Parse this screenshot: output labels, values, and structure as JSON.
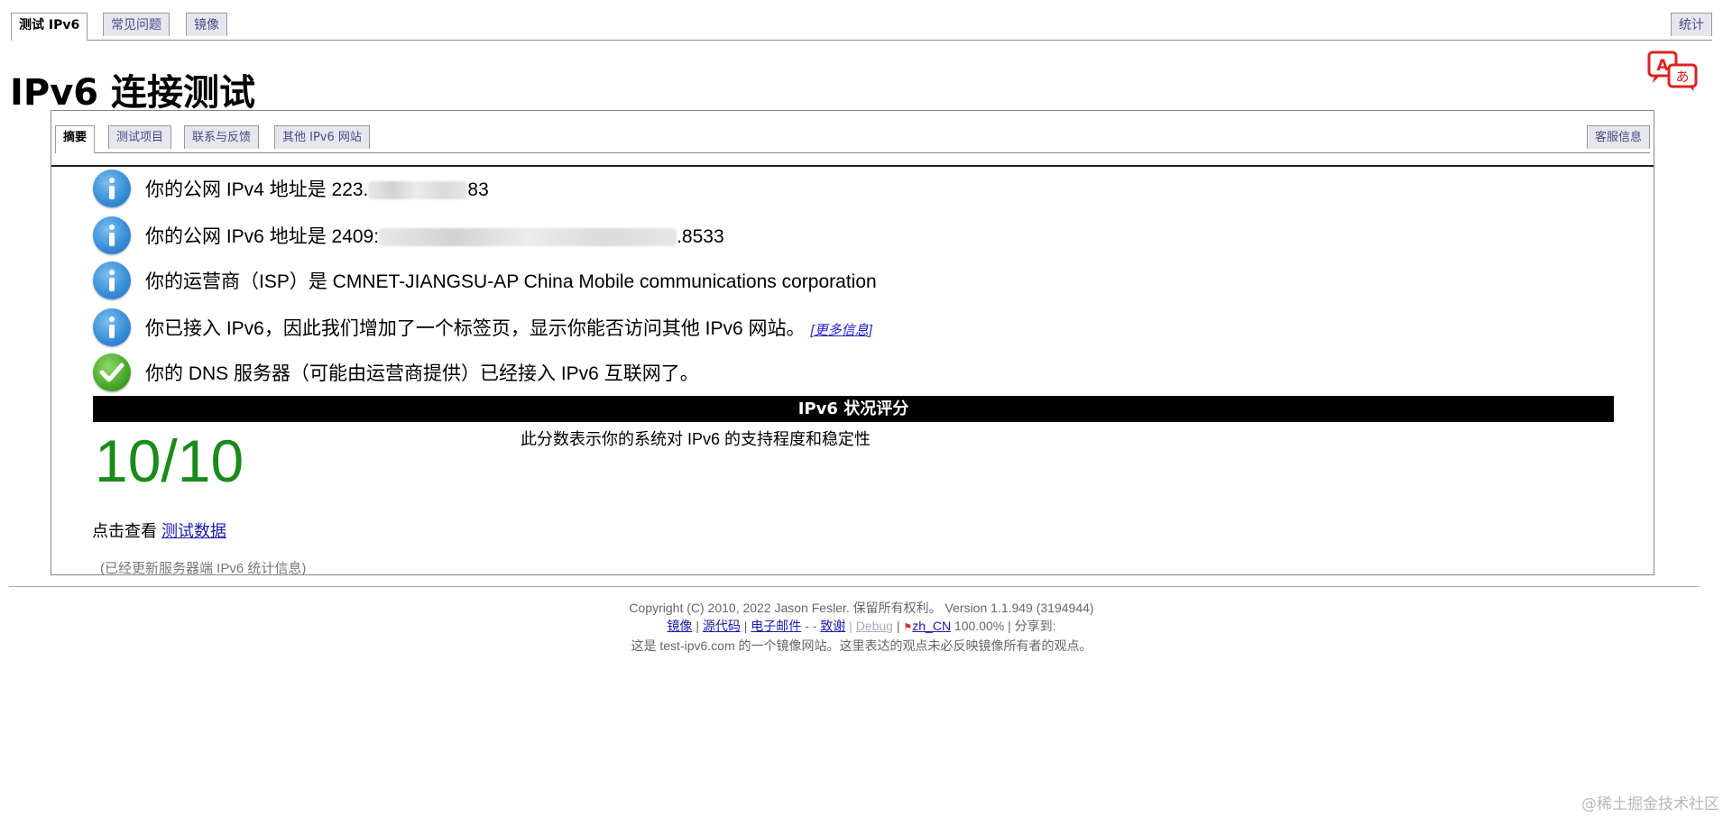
{
  "top_tabs": {
    "test": "测试 IPv6",
    "faq": "常见问题",
    "mirrors": "镜像",
    "stats": "统计"
  },
  "title": "IPv6 连接测试",
  "inner_tabs": {
    "summary": "摘要",
    "tests": "测试项目",
    "contact": "联系与反馈",
    "other_sites": "其他 IPv6 网站",
    "support": "客服信息"
  },
  "info": {
    "ipv4_prefix": "你的公网 IPv4 地址是 223.",
    "ipv4_suffix": "83",
    "ipv6_prefix": "你的公网 IPv6 地址是 2409:",
    "ipv6_suffix": ".8533",
    "isp": "你的运营商（ISP）是 CMNET-JIANGSU-AP China Mobile communications corporation",
    "ipv6_tab": "你已接入 IPv6，因此我们增加了一个标签页，显示你能否访问其他 IPv6 网站。",
    "more_info": "[更多信息]",
    "dns": "你的 DNS 服务器（可能由运营商提供）已经接入 IPv6 互联网了。"
  },
  "score": {
    "header": "IPv6 状况评分",
    "value": "10/10",
    "description": "此分数表示你的系统对 IPv6 的支持程度和稳定性"
  },
  "click_view": {
    "prefix": "点击查看",
    "link": "测试数据"
  },
  "stats_note": "(已经更新服务器端 IPv6 统计信息)",
  "footer": {
    "copyright": "Copyright (C) 2010, 2022 Jason Fesler. 保留所有权利。 Version 1.1.949 (3194944)",
    "mirrors": "镜像",
    "source": "源代码",
    "email": "电子邮件",
    "email_tail": "-    -",
    "thanks": "致谢",
    "debug": "Debug",
    "locale": "zh_CN",
    "locale_pct": "100.00%",
    "share": "| 分享到:",
    "mirror_note": "这是 test-ipv6.com 的一个镜像网站。这里表达的观点未必反映镜像所有者的观点。"
  },
  "watermark": "@稀土掘金技术社区",
  "colors": {
    "score_green": "#1a8a1a",
    "info_blue": "#3a8fd8",
    "ok_green": "#49a52b"
  },
  "icons": {
    "info": "info-circle-icon",
    "ok": "checkmark-circle-icon",
    "translate": "translate-icon"
  }
}
